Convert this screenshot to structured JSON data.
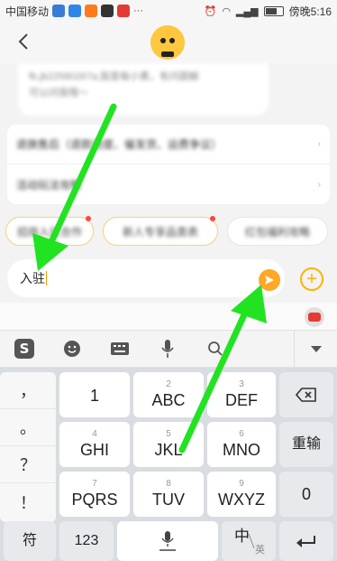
{
  "status_bar": {
    "carrier": "中国移动",
    "time": "傍晚5:16",
    "battery": 67
  },
  "chat": {
    "bubble_lines": [
      "fb.jb22580267a,我是每小黄，有问题解",
      "可以问我哦～"
    ],
    "card_rows": [
      {
        "label": "退换售后（退款进度、催发货、运费争议）"
      },
      {
        "label": "活动玩法攻略"
      }
    ],
    "chips": [
      {
        "label": "招商入驻合作"
      },
      {
        "label": "新人专享品类表"
      },
      {
        "label": "红包福利攻略"
      }
    ]
  },
  "input": {
    "value": "入驻"
  },
  "keyboard": {
    "symbols": [
      "，",
      "。",
      "？",
      "！"
    ],
    "rows": [
      [
        {
          "sub": "",
          "main": "1"
        },
        {
          "sub": "2",
          "main": "ABC"
        },
        {
          "sub": "3",
          "main": "DEF"
        }
      ],
      [
        {
          "sub": "4",
          "main": "GHI"
        },
        {
          "sub": "5",
          "main": "JKL"
        },
        {
          "sub": "6",
          "main": "MNO"
        }
      ],
      [
        {
          "sub": "7",
          "main": "PQRS"
        },
        {
          "sub": "8",
          "main": "TUV"
        },
        {
          "sub": "9",
          "main": "WXYZ"
        }
      ]
    ],
    "reenter_label": "重输",
    "zero_label": "0",
    "symbol_label": "符",
    "num_label": "123",
    "lang_main": "中",
    "lang_sub": "英"
  },
  "colors": {
    "accent": "#ffa726",
    "arrow": "#22e322"
  }
}
